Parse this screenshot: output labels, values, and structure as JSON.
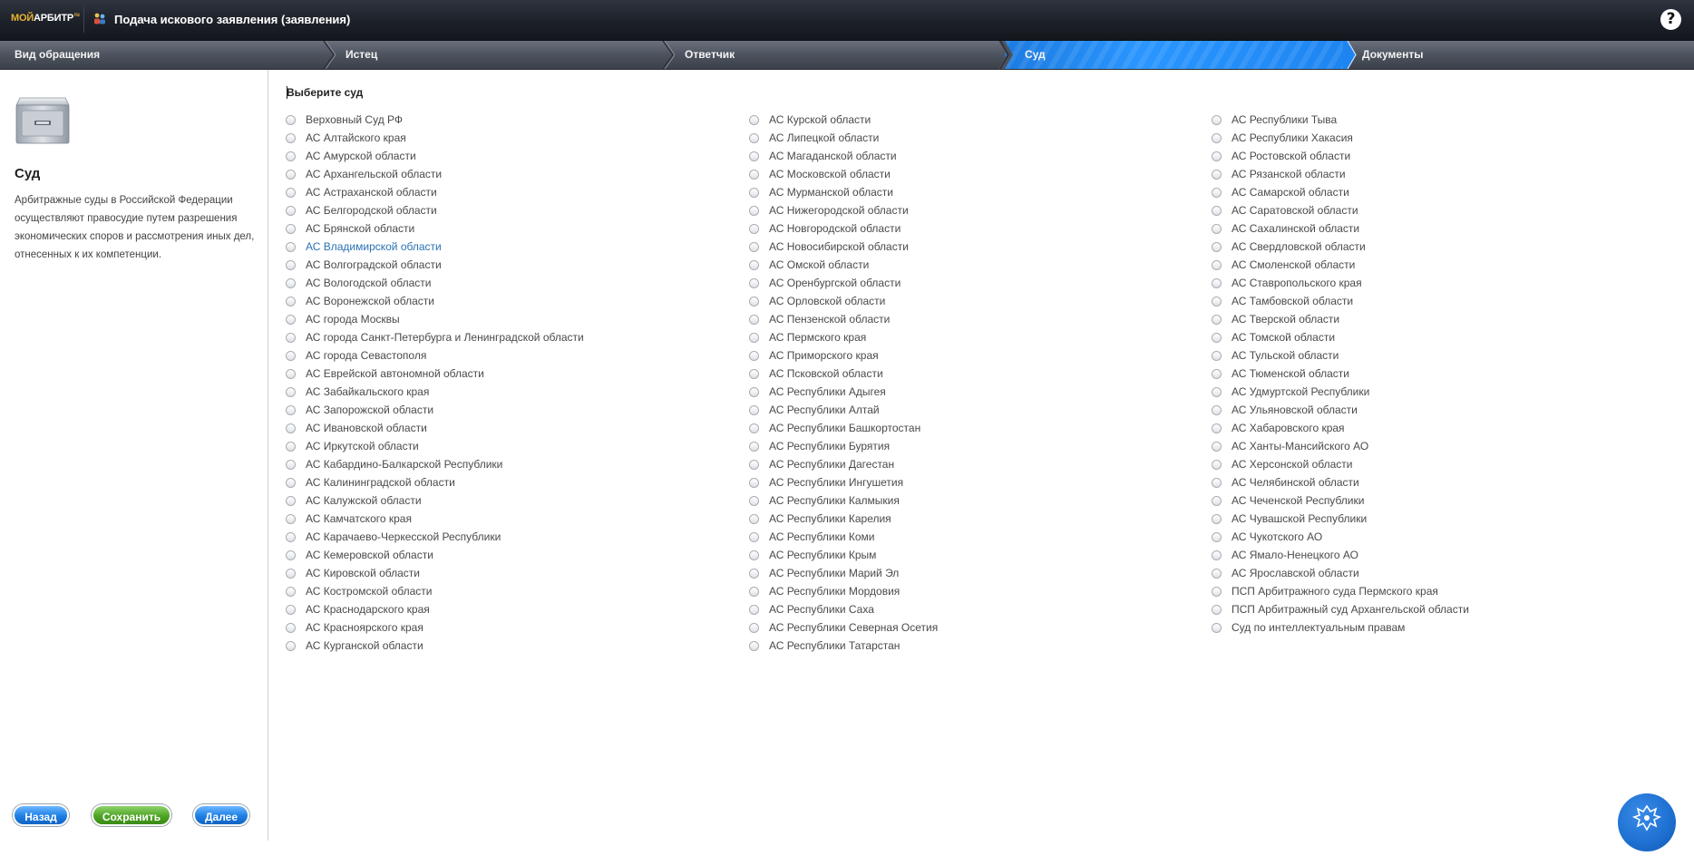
{
  "header": {
    "logo_part1": "МОЙ",
    "logo_part2": "АРБИТР",
    "logo_suffix": "ru",
    "title": "Подача искового заявления (заявления)",
    "help_label": "?"
  },
  "steps": [
    {
      "label": "Вид обращения",
      "active": false
    },
    {
      "label": "Истец",
      "active": false
    },
    {
      "label": "Ответчик",
      "active": false
    },
    {
      "label": "Суд",
      "active": true
    },
    {
      "label": "Документы",
      "active": false
    }
  ],
  "sidebar": {
    "title": "Суд",
    "description": "Арбитражные суды в Российской Федерации осуществляют правосудие путем разрешения экономических споров и рассмотрения иных дел, отнесенных к их компетенции.",
    "back_label": "Назад",
    "save_label": "Сохранить",
    "next_label": "Далее"
  },
  "main": {
    "title": "Выберите суд",
    "hovered_court": "АС Владимирской области",
    "columns": [
      [
        "Верховный Суд РФ",
        "АС Алтайского края",
        "АС Амурской области",
        "АС Архангельской области",
        "АС Астраханской области",
        "АС Белгородской области",
        "АС Брянской области",
        "АС Владимирской области",
        "АС Волгоградской области",
        "АС Вологодской области",
        "АС Воронежской области",
        "АС города Москвы",
        "АС города Санкт-Петербурга и Ленинградской области",
        "АС города Севастополя",
        "АС Еврейской автономной области",
        "АС Забайкальского края",
        "АС Запорожской области",
        "АС Ивановской области",
        "АС Иркутской области",
        "АС Кабардино-Балкарской Республики",
        "АС Калининградской области",
        "АС Калужской области",
        "АС Камчатского края",
        "АС Карачаево-Черкесской Республики",
        "АС Кемеровской области",
        "АС Кировской области",
        "АС Костромской области",
        "АС Краснодарского края",
        "АС Красноярского края",
        "АС Курганской области"
      ],
      [
        "АС Курской области",
        "АС Липецкой области",
        "АС Магаданской области",
        "АС Московской области",
        "АС Мурманской области",
        "АС Нижегородской области",
        "АС Новгородской области",
        "АС Новосибирской области",
        "АС Омской области",
        "АС Оренбургской области",
        "АС Орловской области",
        "АС Пензенской области",
        "АС Пермского края",
        "АС Приморского края",
        "АС Псковской области",
        "АС Республики Адыгея",
        "АС Республики Алтай",
        "АС Республики Башкортостан",
        "АС Республики Бурятия",
        "АС Республики Дагестан",
        "АС Республики Ингушетия",
        "АС Республики Калмыкия",
        "АС Республики Карелия",
        "АС Республики Коми",
        "АС Республики Крым",
        "АС Республики Марий Эл",
        "АС Республики Мордовия",
        "АС Республики Саха",
        "АС Республики Северная Осетия",
        "АС Республики Татарстан"
      ],
      [
        "АС Республики Тыва",
        "АС Республики Хакасия",
        "АС Ростовской области",
        "АС Рязанской области",
        "АС Самарской области",
        "АС Саратовской области",
        "АС Сахалинской области",
        "АС Свердловской области",
        "АС Смоленской области",
        "АС Ставропольского края",
        "АС Тамбовской области",
        "АС Тверской области",
        "АС Томской области",
        "АС Тульской области",
        "АС Тюменской области",
        "АС Удмуртской Республики",
        "АС Ульяновской области",
        "АС Хабаровского края",
        "АС Ханты-Мансийского АО",
        "АС Херсонской области",
        "АС Челябинской области",
        "АС Чеченской Республики",
        "АС Чувашской Республики",
        "АС Чукотского АО",
        "АС Ямало-Ненецкого АО",
        "АС Ярославской области",
        "ПСП Арбитражного суда Пермского края",
        "ПСП Арбитражный суд Архангельской области",
        "Суд по интеллектуальным правам"
      ]
    ]
  },
  "colors": {
    "active_step": "#1e85f0",
    "save_button": "#4ea424",
    "nav_button": "#1d7fe4",
    "hover_text": "#2a72b5"
  },
  "icons": [
    "app-people-icon",
    "help-icon",
    "court-cabinet-icon",
    "state-emblem-icon"
  ]
}
